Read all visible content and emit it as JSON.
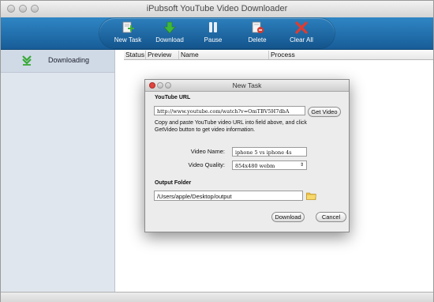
{
  "window": {
    "title": "iPubsoft YouTube Video Downloader"
  },
  "toolbar": {
    "new_task": "New Task",
    "download": "Download",
    "pause": "Pause",
    "delete": "Delete",
    "clear_all": "Clear All"
  },
  "sidebar": {
    "items": [
      {
        "label": "Downloading",
        "icon": "download-arrow-icon"
      }
    ]
  },
  "list": {
    "columns": [
      "Status",
      "Preview",
      "Name",
      "Process"
    ]
  },
  "dialog": {
    "title": "New Task",
    "url_section": "YouTube URL",
    "url_value": "http://www.youtube.com/watch?v=OmTBV5H7dbA",
    "get_video": "Get Video",
    "hint": "Copy and paste YouTube video URL into field above, and click GetVideo button to get video information.",
    "video_name_label": "Video Name:",
    "video_name_value": "iphone 5 vs iphone 4s",
    "video_quality_label": "Video Quality:",
    "video_quality_value": "854x480 webm",
    "output_section": "Output Folder",
    "output_value": "/Users/apple/Desktop/output",
    "download": "Download",
    "cancel": "Cancel"
  },
  "colors": {
    "toolbar": "#2a7bbb",
    "close": "#e0443e",
    "minimize": "#dfa123",
    "zoom": "#27aa35"
  }
}
